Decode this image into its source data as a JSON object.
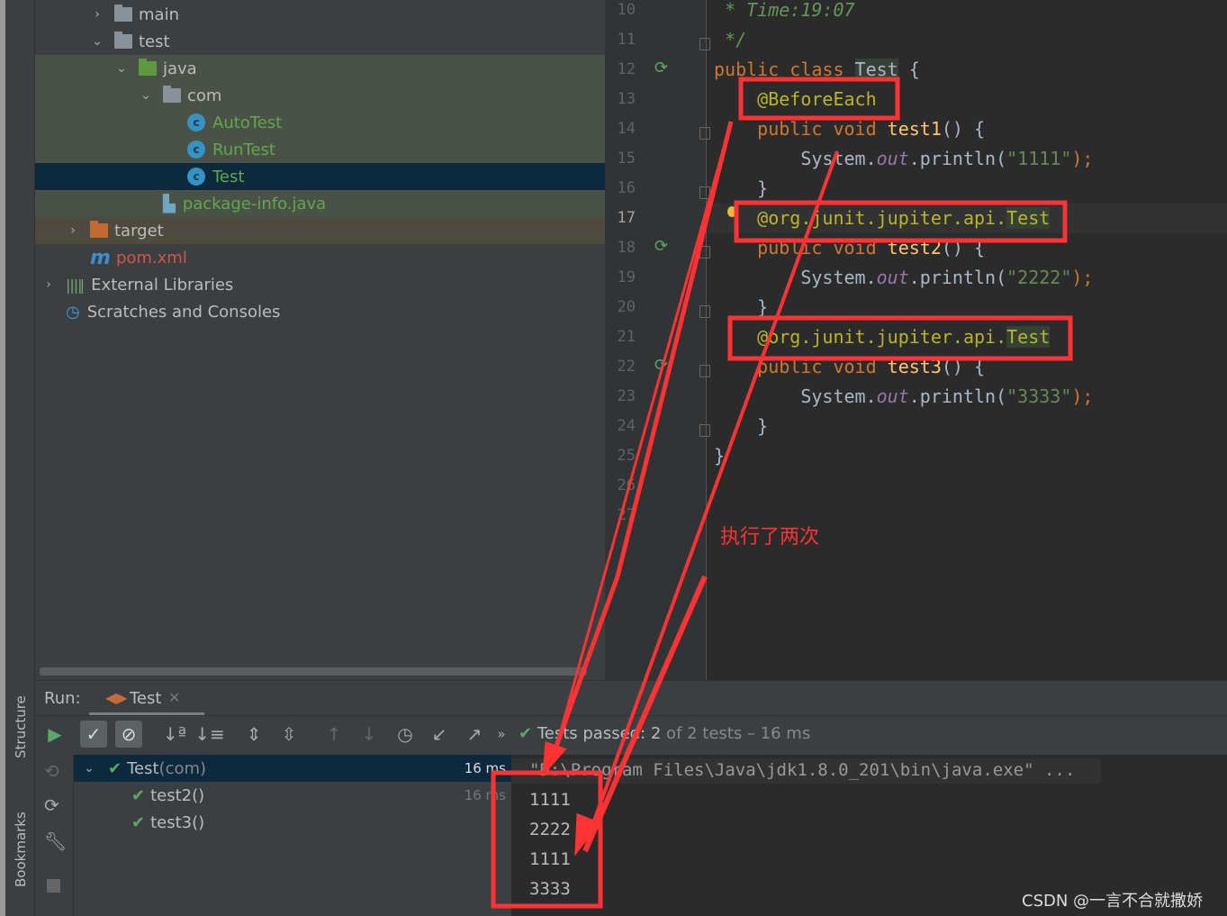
{
  "project_tree": [
    {
      "label": "main",
      "indent": 62,
      "chev": "›",
      "icon": "folder",
      "color": "#bbbbbb",
      "bg": ""
    },
    {
      "label": "test",
      "indent": 62,
      "chev": "⌄",
      "icon": "folder",
      "color": "#bbbbbb",
      "bg": ""
    },
    {
      "label": "java",
      "indent": 89,
      "chev": "⌄",
      "icon": "folder-green",
      "color": "#bbbbbb",
      "bg": "#4a5248"
    },
    {
      "label": "com",
      "indent": 116,
      "chev": "⌄",
      "icon": "package",
      "color": "#bbbbbb",
      "bg": "#4a5248"
    },
    {
      "label": "AutoTest",
      "indent": 143,
      "chev": "",
      "icon": "class",
      "color": "#62a84a",
      "bg": "#4a5248"
    },
    {
      "label": "RunTest",
      "indent": 143,
      "chev": "",
      "icon": "class",
      "color": "#62a84a",
      "bg": "#4a5248"
    },
    {
      "label": "Test",
      "indent": 143,
      "chev": "",
      "icon": "class",
      "color": "#62a84a",
      "bg": "#0d293e"
    },
    {
      "label": "package-info.java",
      "indent": 116,
      "chev": "",
      "icon": "java-file",
      "color": "#62a84a",
      "bg": "#4a5248"
    },
    {
      "label": "target",
      "indent": 35,
      "chev": "›",
      "icon": "folder-orange",
      "color": "#bbbbbb",
      "bg": "#4e4a3f"
    },
    {
      "label": "pom.xml",
      "indent": 35,
      "chev": "",
      "icon": "maven",
      "color": "#d2554a",
      "bg": ""
    },
    {
      "label": "External Libraries",
      "indent": 8,
      "chev": "›",
      "icon": "libraries",
      "color": "#bbbbbb",
      "bg": ""
    },
    {
      "label": "Scratches and Consoles",
      "indent": 8,
      "chev": "",
      "icon": "scratches",
      "color": "#bbbbbb",
      "bg": ""
    }
  ],
  "editor": {
    "lines": [
      {
        "n": "10",
        "tokens": [
          [
            " * Time:19:07",
            "cm"
          ]
        ]
      },
      {
        "n": "11",
        "tokens": [
          [
            " */",
            "cm"
          ]
        ]
      },
      {
        "n": "12",
        "tokens": [
          [
            "public class ",
            "kw"
          ],
          [
            "Test",
            "hl"
          ],
          [
            " {",
            ""
          ]
        ]
      },
      {
        "n": "13",
        "tokens": [
          [
            "    ",
            ""
          ],
          [
            "@BeforeEach",
            "an"
          ]
        ]
      },
      {
        "n": "14",
        "tokens": [
          [
            "    ",
            ""
          ],
          [
            "public void ",
            "kw"
          ],
          [
            "test1",
            "fn"
          ],
          [
            "() {",
            ""
          ]
        ]
      },
      {
        "n": "15",
        "tokens": [
          [
            "        System.",
            ""
          ],
          [
            "out",
            "fd"
          ],
          [
            ".println(",
            ""
          ],
          [
            "\"1111\"",
            "st"
          ],
          [
            ");",
            "kw"
          ]
        ]
      },
      {
        "n": "16",
        "tokens": [
          [
            "    }",
            ""
          ]
        ]
      },
      {
        "n": "17",
        "tokens": [
          [
            "    ",
            ""
          ],
          [
            "@org.junit.jupiter.api.",
            "an"
          ],
          [
            "Test",
            "an hl"
          ]
        ]
      },
      {
        "n": "18",
        "tokens": [
          [
            "    ",
            ""
          ],
          [
            "public void ",
            "kw"
          ],
          [
            "test2",
            "fn"
          ],
          [
            "() {",
            ""
          ]
        ]
      },
      {
        "n": "19",
        "tokens": [
          [
            "        System.",
            ""
          ],
          [
            "out",
            "fd"
          ],
          [
            ".println(",
            ""
          ],
          [
            "\"2222\"",
            "st"
          ],
          [
            ");",
            "kw"
          ]
        ]
      },
      {
        "n": "20",
        "tokens": [
          [
            "    }",
            ""
          ]
        ]
      },
      {
        "n": "21",
        "tokens": [
          [
            "    ",
            ""
          ],
          [
            "@org.junit.jupiter.api.",
            "an"
          ],
          [
            "Test",
            "an hl"
          ]
        ]
      },
      {
        "n": "22",
        "tokens": [
          [
            "    ",
            ""
          ],
          [
            "public void ",
            "kw"
          ],
          [
            "test3",
            "fn"
          ],
          [
            "() {",
            ""
          ]
        ]
      },
      {
        "n": "23",
        "tokens": [
          [
            "        System.",
            ""
          ],
          [
            "out",
            "fd"
          ],
          [
            ".println(",
            ""
          ],
          [
            "\"3333\"",
            "st"
          ],
          [
            ");",
            "kw"
          ]
        ]
      },
      {
        "n": "24",
        "tokens": [
          [
            "    }",
            ""
          ]
        ]
      },
      {
        "n": "25",
        "tokens": [
          [
            "}",
            ""
          ]
        ]
      },
      {
        "n": "26",
        "tokens": []
      },
      {
        "n": "27",
        "tokens": []
      }
    ]
  },
  "run": {
    "label": "Run:",
    "tab": "Test",
    "status_prefix": "Tests passed: 2",
    "status_suffix": " of 2 tests – 16 ms",
    "tree": [
      {
        "name": "Test",
        "pkg": " (com)",
        "time": "16 ms"
      },
      {
        "name": "test2()",
        "pkg": "",
        "time": "16 ms"
      },
      {
        "name": "test3()",
        "pkg": "",
        "time": ""
      }
    ],
    "console": {
      "cmd": "\"D:\\Program Files\\Java\\jdk1.8.0_201\\bin\\java.exe\" ...",
      "output": [
        "1111",
        "2222",
        "1111",
        "3333"
      ]
    }
  },
  "side_tabs": {
    "structure": "Structure",
    "bookmarks": "Bookmarks"
  },
  "annotation": {
    "text": "执行了两次",
    "color": "#ff3333"
  },
  "watermark": "CSDN @一言不合就撒娇"
}
